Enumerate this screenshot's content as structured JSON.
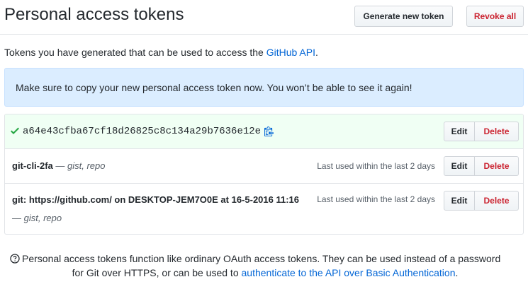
{
  "header": {
    "title": "Personal access tokens",
    "generate_label": "Generate new token",
    "revoke_label": "Revoke all"
  },
  "intro": {
    "text": "Tokens you have generated that can be used to access the ",
    "link": "GitHub API",
    "suffix": "."
  },
  "flash": {
    "message": "Make sure to copy your new personal access token now. You won’t be able to see it again!"
  },
  "tokens": {
    "new_token": {
      "value": "a64e43cfba67cf18d26825c8c134a29b7636e12e",
      "edit_label": "Edit",
      "delete_label": "Delete"
    },
    "items": [
      {
        "name": "git-cli-2fa",
        "scopes": " — gist, repo",
        "last_used": "Last used within the last 2 days",
        "edit_label": "Edit",
        "delete_label": "Delete"
      },
      {
        "name": "git: https://github.com/ on DESKTOP-JEM7O0E at 16-5-2016 11:16",
        "scopes": "— gist, repo",
        "last_used": "Last used within the last 2 days",
        "edit_label": "Edit",
        "delete_label": "Delete"
      }
    ]
  },
  "footer": {
    "text1": "Personal access tokens function like ordinary OAuth access tokens. They can be used instead of a password",
    "text2": "for Git over HTTPS, or can be used to ",
    "link": "authenticate to the API over Basic Authentication",
    "suffix": "."
  },
  "icons": {
    "check": "check-icon",
    "copy": "clippy-icon",
    "info": "question-icon"
  },
  "colors": {
    "link": "#0366d6",
    "danger": "#cb2431",
    "success": "#28a745",
    "flash_bg": "#dbedff"
  }
}
